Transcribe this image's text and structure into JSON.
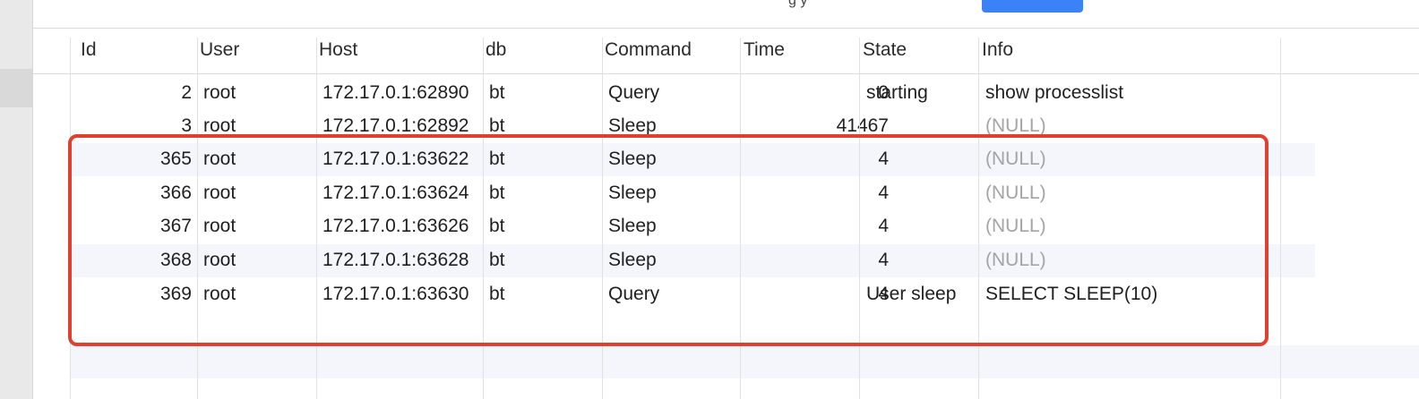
{
  "toolbar": {
    "partial_text": "g                    y"
  },
  "table": {
    "columns": [
      "Id",
      "User",
      "Host",
      "db",
      "Command",
      "Time",
      "State",
      "Info"
    ],
    "rows": [
      {
        "id": "2",
        "user": "root",
        "host": "172.17.0.1:62890",
        "db": "bt",
        "command": "Query",
        "time": "0",
        "state": "starting",
        "info": "show processlist",
        "info_null": false
      },
      {
        "id": "3",
        "user": "root",
        "host": "172.17.0.1:62892",
        "db": "bt",
        "command": "Sleep",
        "time": "41467",
        "state": "",
        "info": "(NULL)",
        "info_null": true
      },
      {
        "id": "365",
        "user": "root",
        "host": "172.17.0.1:63622",
        "db": "bt",
        "command": "Sleep",
        "time": "4",
        "state": "",
        "info": "(NULL)",
        "info_null": true
      },
      {
        "id": "366",
        "user": "root",
        "host": "172.17.0.1:63624",
        "db": "bt",
        "command": "Sleep",
        "time": "4",
        "state": "",
        "info": "(NULL)",
        "info_null": true
      },
      {
        "id": "367",
        "user": "root",
        "host": "172.17.0.1:63626",
        "db": "bt",
        "command": "Sleep",
        "time": "4",
        "state": "",
        "info": "(NULL)",
        "info_null": true
      },
      {
        "id": "368",
        "user": "root",
        "host": "172.17.0.1:63628",
        "db": "bt",
        "command": "Sleep",
        "time": "4",
        "state": "",
        "info": "(NULL)",
        "info_null": true
      },
      {
        "id": "369",
        "user": "root",
        "host": "172.17.0.1:63630",
        "db": "bt",
        "command": "Query",
        "time": "4",
        "state": "User sleep",
        "info": "SELECT SLEEP(10)",
        "info_null": false
      }
    ]
  },
  "colors": {
    "highlight_border": "#e0402f",
    "accent_button": "#3b82f6",
    "null_text": "#a4a4a4",
    "alt_row": "#f4f6fb"
  }
}
